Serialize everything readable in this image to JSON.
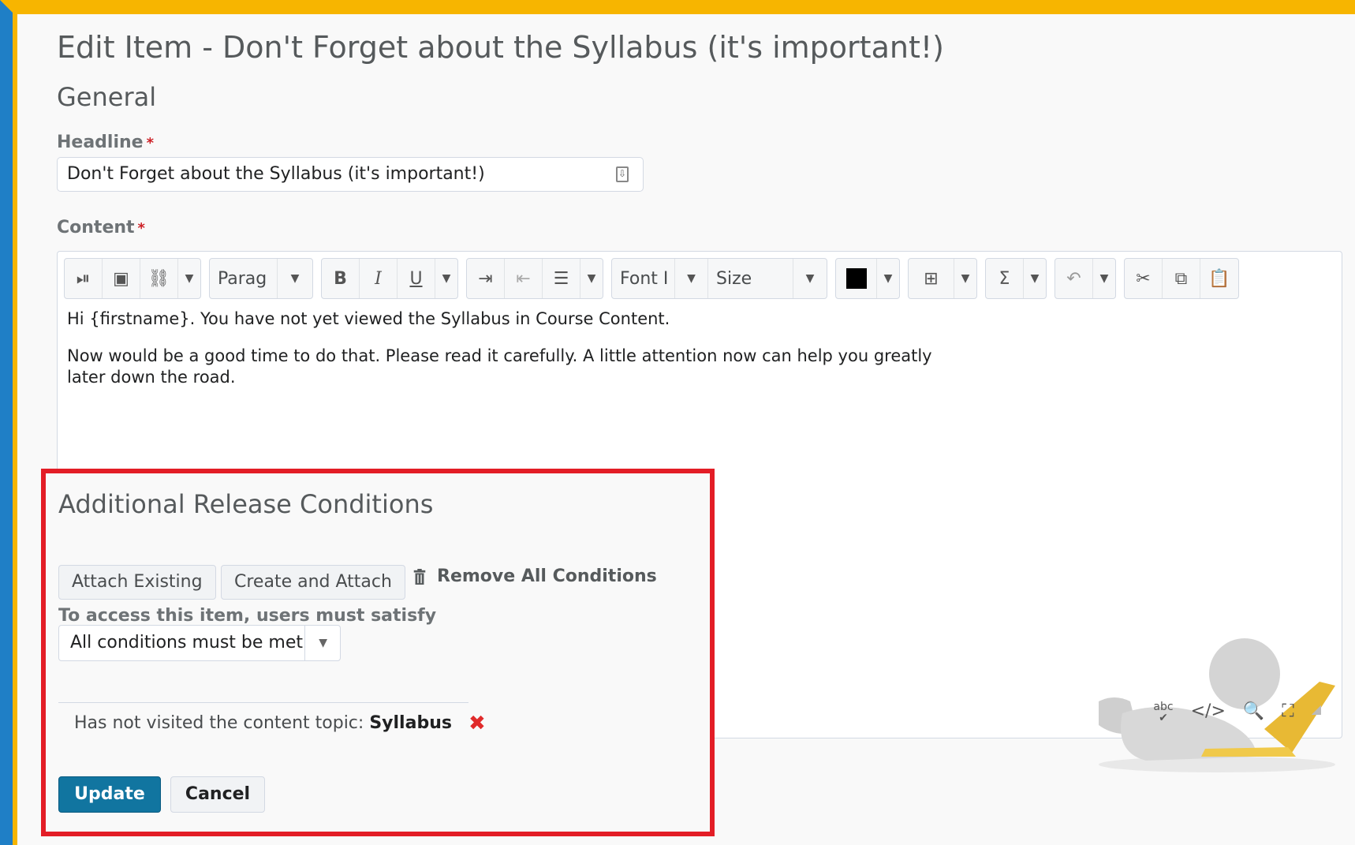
{
  "page": {
    "title": "Edit Item - Don't Forget about the Syllabus (it's important!)",
    "section_general": "General"
  },
  "headline": {
    "label": "Headline",
    "required_mark": "*",
    "value": "Don't Forget about the Syllabus (it's important!)"
  },
  "content": {
    "label": "Content",
    "required_mark": "*",
    "toolbar": {
      "paragraph_label": "Parag",
      "font_label": "Font I",
      "size_label": "Size"
    },
    "paragraph1": "Hi {firstname}. You have not yet viewed the Syllabus in Course Content.",
    "paragraph2": "Now would be a good time to do that. Please read it carefully. A little attention now can help you greatly later down the road.",
    "statusbar": {
      "spellcheck_label": "abc"
    }
  },
  "release_conditions": {
    "title": "Additional Release Conditions",
    "attach_existing_label": "Attach Existing",
    "create_attach_label": "Create and Attach",
    "remove_all_label": "Remove All Conditions",
    "access_label": "To access this item, users must satisfy",
    "select_value": "All conditions must be met",
    "condition_prefix": "Has not visited the content topic:",
    "condition_topic": "Syllabus"
  },
  "actions": {
    "update_label": "Update",
    "cancel_label": "Cancel"
  },
  "colors": {
    "highlight_border": "#e31d26",
    "primary_button": "#1175a0",
    "frame_yellow": "#f7b500",
    "frame_blue": "#1f7fc6"
  }
}
